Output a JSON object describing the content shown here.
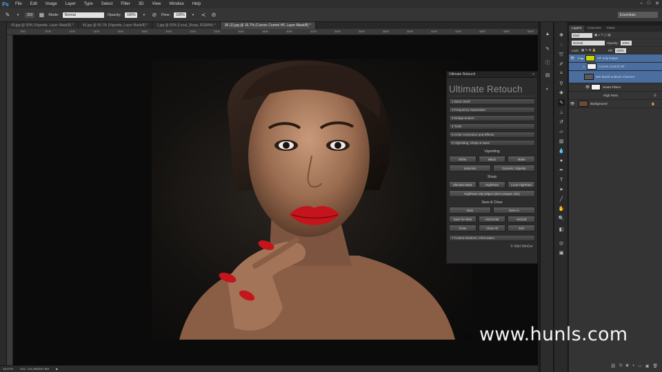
{
  "app": {
    "logo": "Ps"
  },
  "menu": [
    "File",
    "Edit",
    "Image",
    "Layer",
    "Type",
    "Select",
    "Filter",
    "3D",
    "View",
    "Window",
    "Help"
  ],
  "options_bar": {
    "brush_size": "303",
    "mode_label": "Mode:",
    "mode_value": "Normal",
    "opacity_label": "Opacity:",
    "opacity_value": "100%",
    "flow_label": "Flow:",
    "flow_value": "100%",
    "workspace": "Essentials"
  },
  "tabs": [
    {
      "label": "43.jpg @ 50% (Vignette, Layer Mask/8) *",
      "active": false
    },
    {
      "label": "43.jpg @ 66.7% (Vignette, Layer Mask/8) *",
      "active": false
    },
    {
      "label": "1.jpg @ 50% (Local_Sharp, RGB/8#) *",
      "active": false
    },
    {
      "label": "36 (2).jpg @ 16.7% (Curves Control HF, Layer Mask/8) *",
      "active": true
    }
  ],
  "rulers": [
    "500",
    "1000",
    "1200",
    "1400",
    "1600",
    "1800",
    "2000",
    "2200",
    "2400",
    "2600",
    "2800",
    "3000",
    "3200",
    "3400",
    "3600",
    "3800",
    "4000",
    "4200",
    "4400",
    "4600",
    "4800",
    "5000"
  ],
  "status": {
    "zoom": "16.67%",
    "doc": "Doc: 101,8M/257,8M"
  },
  "ultimate_retouch": {
    "header": "Ultimate Retouch",
    "title": "Ultimate Retouch",
    "sections": [
      "1 Basic Work",
      "2 Frequency Separation",
      "3 Dodge & Burn",
      "4 Tools",
      "5 Color Correction and Effects",
      "6 Vignetting, Sharp & Save"
    ],
    "vignetting": {
      "label": "Vignetting",
      "row1": [
        "White",
        "Black",
        "Matte"
      ],
      "row2": [
        "Selection",
        "Dynamic Vignette"
      ]
    },
    "sharp": {
      "label": "Sharp",
      "row1": [
        "Ultimate Mask",
        "HighPass",
        "Local HighPass"
      ],
      "row2": [
        "HighPass only Edges (don't prepare skin)"
      ]
    },
    "save_close": {
      "label": "Save & Close",
      "row1": [
        "Save",
        "Save to"
      ],
      "row2": [
        "Save for Web",
        "Horizontal",
        "Vertical"
      ],
      "row3": [
        "Close",
        "Close All",
        "Exit"
      ]
    },
    "custom": "7 Custom Buttons, Information",
    "footer": "© Wild WinDer"
  },
  "layers_panel": {
    "tabs": [
      "Layers",
      "Channels",
      "Paths"
    ],
    "kind": "Kind",
    "blend": "Normal",
    "opacity_label": "Opacity:",
    "opacity_value": "100%",
    "lock_label": "Lock:",
    "fill_label": "Fill:",
    "fill_value": "100%",
    "layers": [
      {
        "name": "HF only Edges",
        "selected": true
      },
      {
        "name": "Curves Control HF",
        "selected": true
      },
      {
        "name": "BW Maxilt & Black Channel",
        "selected": true
      },
      {
        "name": "Smart Filters",
        "selected": false
      },
      {
        "name": "High Pass",
        "selected": false
      },
      {
        "name": "Background",
        "selected": false
      }
    ]
  },
  "watermark": "www.hunls.com",
  "colors": {
    "accent": "#4a6ea0",
    "lipstick": "#c4151c"
  }
}
